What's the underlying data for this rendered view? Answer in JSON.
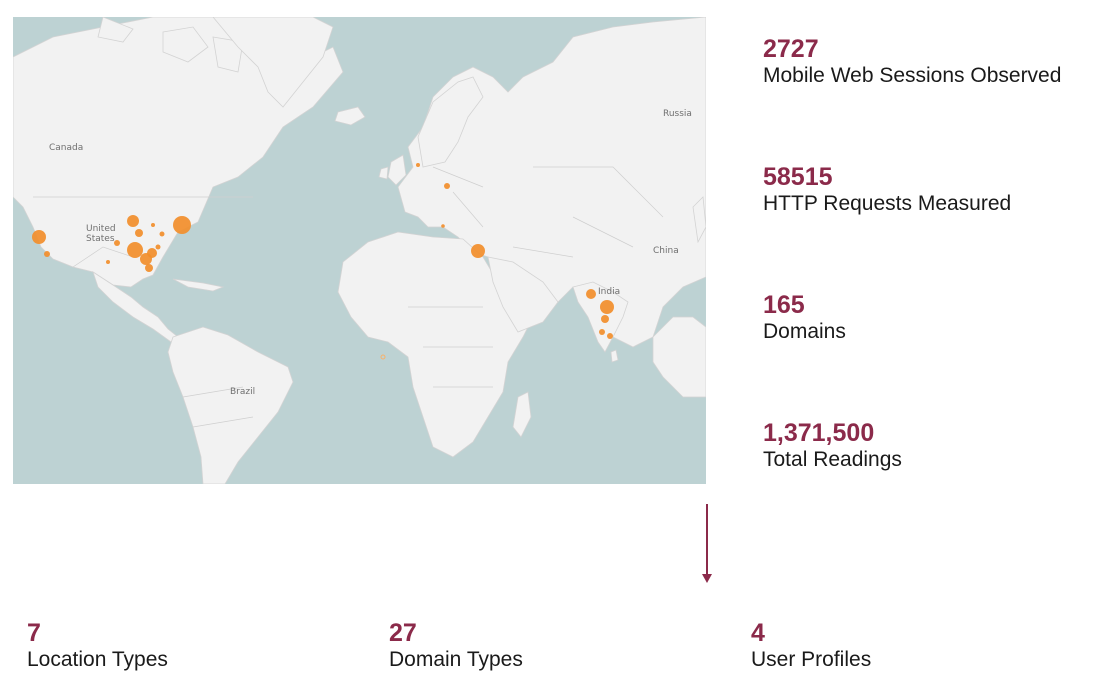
{
  "map": {
    "labels": {
      "canada": "Canada",
      "united_states_1": "United",
      "united_states_2": "States",
      "brazil": "Brazil",
      "russia": "Russia",
      "china": "China",
      "india": "India"
    },
    "colors": {
      "ocean": "#bdd2d3",
      "land": "#f2f2f2",
      "marker": "#f28e2b"
    }
  },
  "stats": {
    "sessions": {
      "value": "2727",
      "label": "Mobile Web Sessions Observed"
    },
    "requests": {
      "value": "58515",
      "label": "HTTP Requests Measured"
    },
    "domains": {
      "value": "165",
      "label": "Domains"
    },
    "readings": {
      "value": "1,371,500",
      "label": "Total Readings"
    }
  },
  "breakdown": {
    "location_types": {
      "value": "7",
      "label": "Location Types"
    },
    "domain_types": {
      "value": "27",
      "label": "Domain Types"
    },
    "user_profiles": {
      "value": "4",
      "label": "User Profiles"
    }
  },
  "colors": {
    "accent": "#8b2a4a",
    "text": "#1a1a1a"
  }
}
